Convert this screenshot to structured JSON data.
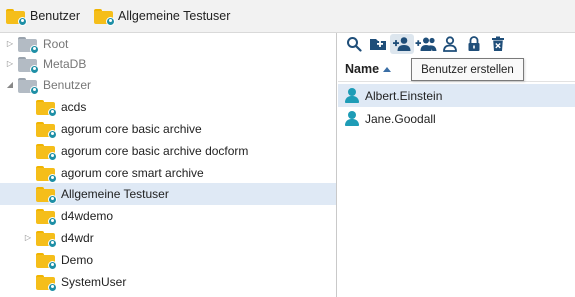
{
  "breadcrumb": {
    "items": [
      {
        "label": "Benutzer",
        "icon": "user-folder-icon"
      },
      {
        "label": "Allgemeine Testuser",
        "icon": "user-folder-icon"
      }
    ]
  },
  "tree": {
    "nodes": [
      {
        "label": "Root",
        "icon": "gray-folder-icon",
        "toggle": "collapsed"
      },
      {
        "label": "MetaDB",
        "icon": "gray-folder-icon",
        "toggle": "collapsed"
      },
      {
        "label": "Benutzer",
        "icon": "gray-folder-icon",
        "toggle": "expanded"
      },
      {
        "label": "acds",
        "icon": "user-folder-icon"
      },
      {
        "label": "agorum core basic archive",
        "icon": "user-folder-icon"
      },
      {
        "label": "agorum core basic archive docform",
        "icon": "user-folder-icon"
      },
      {
        "label": "agorum core smart archive",
        "icon": "user-folder-icon"
      },
      {
        "label": "Allgemeine Testuser",
        "icon": "user-folder-icon",
        "selected": true
      },
      {
        "label": "d4wdemo",
        "icon": "user-folder-icon"
      },
      {
        "label": "d4wdr",
        "icon": "user-folder-icon",
        "toggle": "collapsed"
      },
      {
        "label": "Demo",
        "icon": "user-folder-icon"
      },
      {
        "label": "SystemUser",
        "icon": "user-folder-icon"
      }
    ]
  },
  "toolbar": {
    "buttons": [
      {
        "name": "search-icon"
      },
      {
        "name": "new-folder-icon"
      },
      {
        "name": "add-user-icon",
        "active": true
      },
      {
        "name": "add-group-icon"
      },
      {
        "name": "user-icon"
      },
      {
        "name": "lock-icon"
      },
      {
        "name": "delete-icon"
      }
    ]
  },
  "tooltip": {
    "text": "Benutzer erstellen"
  },
  "list": {
    "column_header": "Name",
    "sort": "ascending",
    "rows": [
      {
        "label": "Albert.Einstein",
        "selected": true
      },
      {
        "label": "Jane.Goodall"
      }
    ]
  },
  "colors": {
    "accent": "#1e9cb6",
    "folder": "#f5be1a",
    "selection": "#dfe9f5"
  }
}
